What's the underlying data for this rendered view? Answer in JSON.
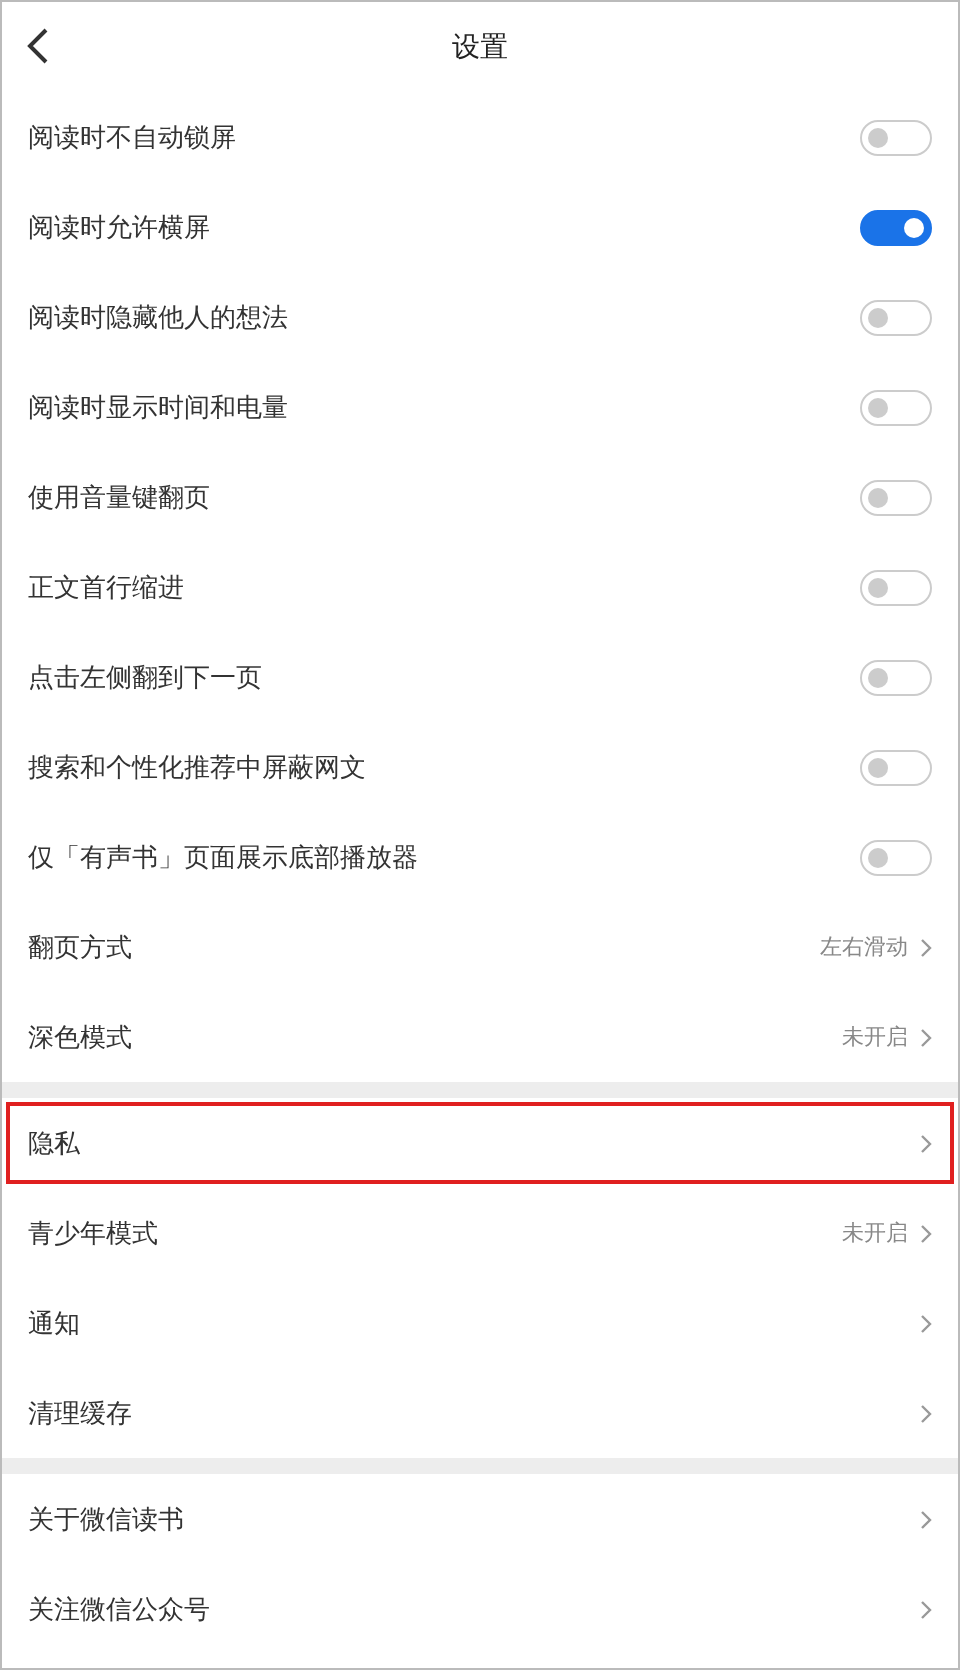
{
  "header": {
    "title": "设置"
  },
  "sections": [
    {
      "rows": [
        {
          "kind": "toggle",
          "label": "阅读时不自动锁屏",
          "on": false
        },
        {
          "kind": "toggle",
          "label": "阅读时允许横屏",
          "on": true
        },
        {
          "kind": "toggle",
          "label": "阅读时隐藏他人的想法",
          "on": false
        },
        {
          "kind": "toggle",
          "label": "阅读时显示时间和电量",
          "on": false
        },
        {
          "kind": "toggle",
          "label": "使用音量键翻页",
          "on": false
        },
        {
          "kind": "toggle",
          "label": "正文首行缩进",
          "on": false
        },
        {
          "kind": "toggle",
          "label": "点击左侧翻到下一页",
          "on": false
        },
        {
          "kind": "toggle",
          "label": "搜索和个性化推荐中屏蔽网文",
          "on": false
        },
        {
          "kind": "toggle",
          "label": "仅「有声书」页面展示底部播放器",
          "on": false
        },
        {
          "kind": "link",
          "label": "翻页方式",
          "value": "左右滑动",
          "highlighted": false
        },
        {
          "kind": "link",
          "label": "深色模式",
          "value": "未开启",
          "highlighted": false
        }
      ]
    },
    {
      "rows": [
        {
          "kind": "link",
          "label": "隐私",
          "highlighted": true
        },
        {
          "kind": "link",
          "label": "青少年模式",
          "value": "未开启",
          "highlighted": false
        },
        {
          "kind": "link",
          "label": "通知",
          "highlighted": false
        },
        {
          "kind": "link",
          "label": "清理缓存",
          "highlighted": false
        }
      ]
    },
    {
      "rows": [
        {
          "kind": "link",
          "label": "关于微信读书",
          "highlighted": false
        },
        {
          "kind": "link",
          "label": "关注微信公众号",
          "highlighted": false
        }
      ]
    }
  ]
}
